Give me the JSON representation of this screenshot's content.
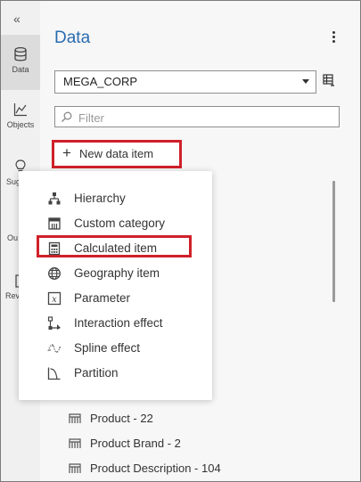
{
  "rail": {
    "collapse_glyph": "«",
    "items": [
      {
        "label": "Data",
        "icon": "database-icon",
        "active": true
      },
      {
        "label": "Objects",
        "icon": "line-chart-icon",
        "active": false
      },
      {
        "label": "Sug",
        "icon": "lightbulb-icon",
        "active": false
      },
      {
        "label": "Ou",
        "icon": "outline-icon",
        "active": false
      },
      {
        "label": "Rev",
        "icon": "report-icon",
        "active": false
      }
    ]
  },
  "panel": {
    "title": "Data",
    "data_source": "MEGA_CORP",
    "filter_placeholder": "Filter",
    "new_data_item_label": "New data item"
  },
  "menu": {
    "items": [
      {
        "label": "Hierarchy",
        "icon": "hierarchy-icon"
      },
      {
        "label": "Custom category",
        "icon": "custom-category-icon"
      },
      {
        "label": "Calculated item",
        "icon": "calculator-icon",
        "highlighted": true
      },
      {
        "label": "Geography item",
        "icon": "globe-icon"
      },
      {
        "label": "Parameter",
        "icon": "parameter-icon"
      },
      {
        "label": "Interaction effect",
        "icon": "interaction-effect-icon"
      },
      {
        "label": "Spline effect",
        "icon": "spline-effect-icon"
      },
      {
        "label": "Partition",
        "icon": "partition-icon"
      }
    ]
  },
  "data_items": [
    {
      "label": "Product - 22",
      "icon": "category-icon"
    },
    {
      "label": "Product Brand - 2",
      "icon": "category-icon"
    },
    {
      "label": "Product Description - 104",
      "icon": "category-icon"
    }
  ],
  "colors": {
    "accent": "#2a6cb0",
    "highlight_border": "#d0202a"
  }
}
